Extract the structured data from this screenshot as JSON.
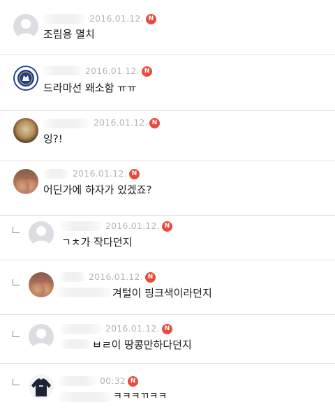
{
  "comments": [
    {
      "date": "2016.01.12.",
      "badge": "N",
      "text": "조림용 멸치",
      "avatar": "default-avatar",
      "reply": false
    },
    {
      "date": "2016.01.12.",
      "badge": "N",
      "text": "드라마선 왜소함 ㅠㅠ",
      "avatar": "chelsea-crest",
      "reply": false
    },
    {
      "date": "2016.01.12.",
      "badge": "N",
      "text": "잉?!",
      "avatar": "photo-avatar",
      "reply": false
    },
    {
      "date": "2016.01.12.",
      "badge": "N",
      "text": "어딘가에 하자가 있겠죠?",
      "avatar": "photo-avatar",
      "reply": false
    },
    {
      "date": "2016.01.12.",
      "badge": "N",
      "text": "ㄱㅊ가 작다던지",
      "avatar": "default-avatar",
      "reply": true
    },
    {
      "date": "2016.01.12.",
      "badge": "N",
      "text": "겨털이 핑크색이라던지",
      "avatar": "photo-avatar",
      "reply": true
    },
    {
      "date": "2016.01.12.",
      "badge": "N",
      "text": "ㅂㄹ이 땅콩만하다던지",
      "avatar": "default-avatar",
      "reply": true
    },
    {
      "date": "00:32",
      "badge": "N",
      "text": "ㅋㅋㅋㄲㅋㅋ",
      "avatar": "sweatshirt-avatar",
      "reply": true
    }
  ]
}
